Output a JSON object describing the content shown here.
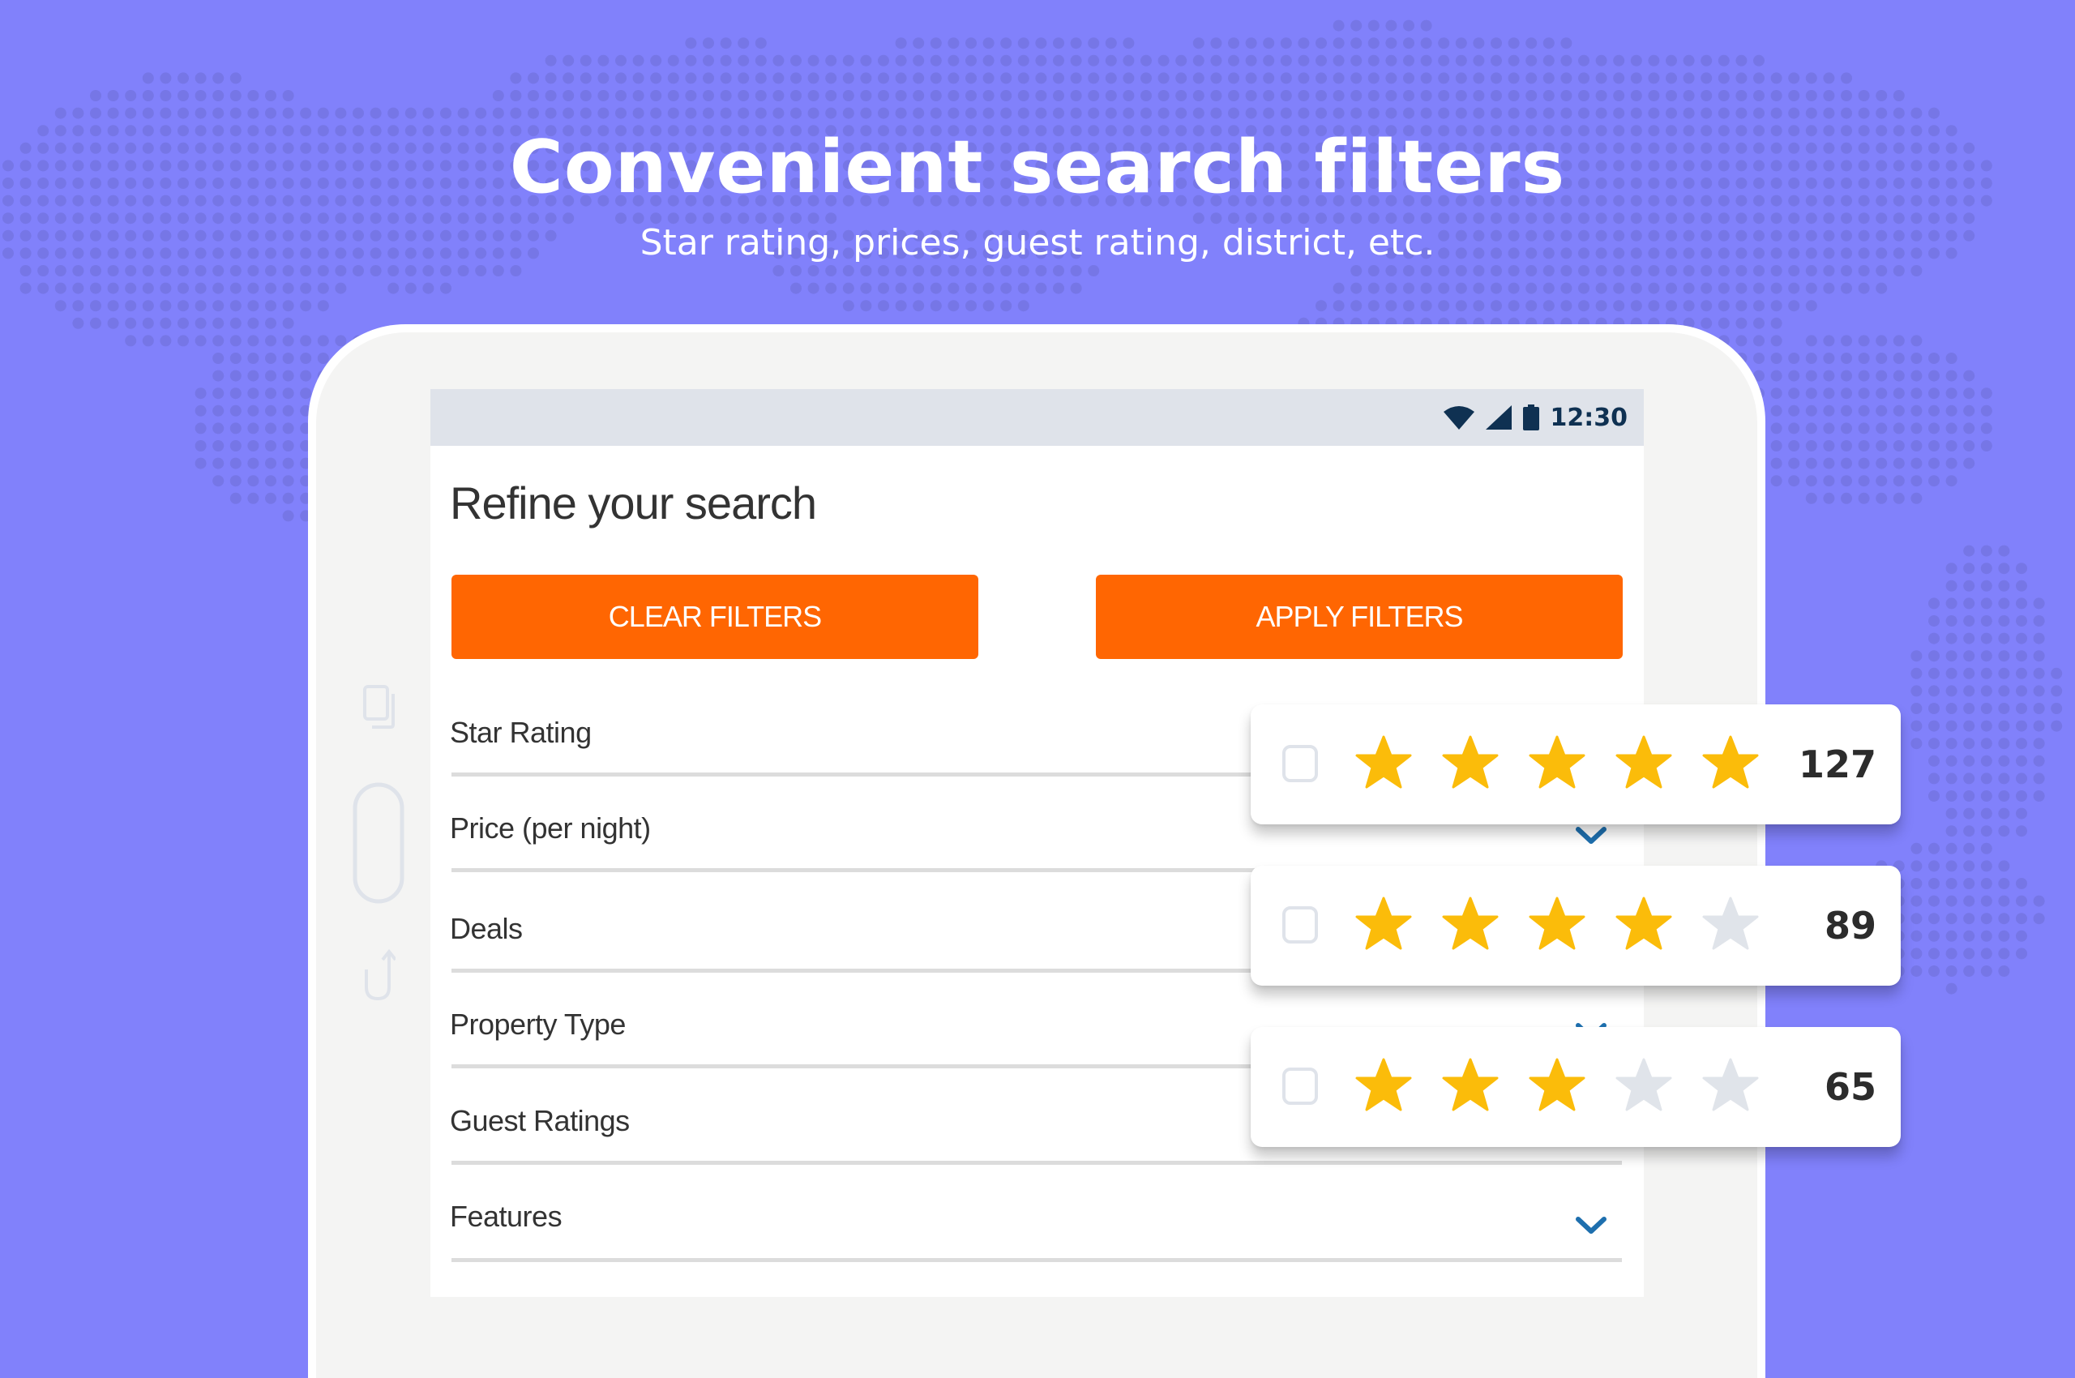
{
  "hero": {
    "title": "Convenient search filters",
    "subtitle": "Star rating, prices, guest rating, district, etc."
  },
  "colors": {
    "background": "#8181fb",
    "dots": "#7676e6",
    "accent_orange": "#ff6602",
    "star_filled": "#fbbc0a",
    "star_empty": "#e0e4ea",
    "chevron": "#1e6fae",
    "status_icons": "#0f3152"
  },
  "device": {
    "side_icons": [
      "recent-apps-icon",
      "home-button-icon",
      "back-icon"
    ]
  },
  "status_bar": {
    "icons": [
      "wifi-icon",
      "cell-signal-icon",
      "battery-icon"
    ],
    "time": "12:30"
  },
  "screen": {
    "title": "Refine your search",
    "buttons": {
      "clear": "CLEAR FILTERS",
      "apply": "APPLY FILTERS"
    },
    "filters": [
      {
        "label": "Star Rating",
        "chevron": false
      },
      {
        "label": "Price (per night)",
        "chevron": true
      },
      {
        "label": "Deals",
        "chevron": false
      },
      {
        "label": "Property Type",
        "chevron": true
      },
      {
        "label": "Guest Ratings",
        "chevron": false
      },
      {
        "label": "Features",
        "chevron": true
      }
    ]
  },
  "star_rating_options": [
    {
      "stars": 5,
      "max": 5,
      "count": "127",
      "checked": false
    },
    {
      "stars": 4,
      "max": 5,
      "count": "89",
      "checked": false
    },
    {
      "stars": 3,
      "max": 5,
      "count": "65",
      "checked": false
    }
  ]
}
